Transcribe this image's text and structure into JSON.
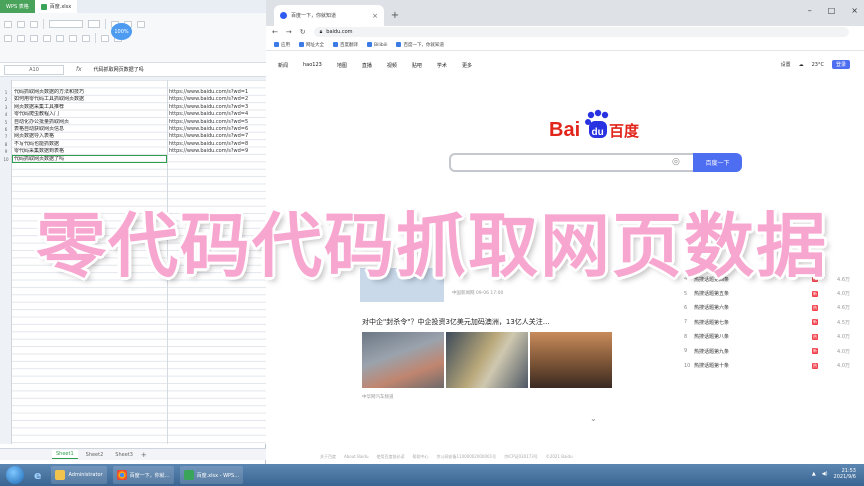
{
  "wps": {
    "tabs": [
      {
        "label": "WPS 表格"
      },
      {
        "label": "百度.xlsx"
      }
    ],
    "toolbar": {
      "zoom": "100%"
    },
    "name_box": "A10",
    "formula": "代码抓取网页数据了吗",
    "rows": [
      {
        "num": "1",
        "a": "代码抓取网页数据的方法和技巧",
        "b": "https://www.baidu.com/s?wd=1"
      },
      {
        "num": "2",
        "a": "如何用零代码工具抓取网页数据",
        "b": "https://www.baidu.com/s?wd=2"
      },
      {
        "num": "3",
        "a": "网页数据采集工具推荐",
        "b": "https://www.baidu.com/s?wd=3"
      },
      {
        "num": "4",
        "a": "零代码爬虫教程入门",
        "b": "https://www.baidu.com/s?wd=4"
      },
      {
        "num": "5",
        "a": "自动化办公批量抓取网页",
        "b": "https://www.baidu.com/s?wd=5"
      },
      {
        "num": "6",
        "a": "表格自动获取网页信息",
        "b": "https://www.baidu.com/s?wd=6"
      },
      {
        "num": "7",
        "a": "网页数据导入表格",
        "b": "https://www.baidu.com/s?wd=7"
      },
      {
        "num": "8",
        "a": "不写代码也能抓数据",
        "b": "https://www.baidu.com/s?wd=8"
      },
      {
        "num": "9",
        "a": "零代码采集数据到表格",
        "b": "https://www.baidu.com/s?wd=9"
      },
      {
        "num": "10",
        "a": "代码抓取网页数据了吗",
        "b": ""
      }
    ],
    "sheets": [
      "Sheet1",
      "Sheet2",
      "Sheet3"
    ],
    "add_sheet": "+"
  },
  "chrome": {
    "tab_title": "百度一下，你就知道",
    "tab_close": "×",
    "new_tab": "+",
    "url": "baidu.com",
    "bookmarks": [
      "应用",
      "网址大全",
      "百度翻译",
      "Bilibili",
      "百度一下，你就知道"
    ]
  },
  "baidu": {
    "nav": [
      "新闻",
      "hao123",
      "地图",
      "直播",
      "视频",
      "贴吧",
      "学术",
      "更多"
    ],
    "right": {
      "settings": "设置",
      "weather": "23°C",
      "login": "登录"
    },
    "logo_text": "Bai du 百度",
    "search_button": "百度一下",
    "news_meta_1": "中国新闻网   09-06 17:00",
    "headline": "对中企\"封杀令\"？中企投资3亿美元加码澳洲，13亿人关注…",
    "news_meta_2": "中华网汽车频道",
    "hot_list": [
      {
        "rank": "4",
        "title": "热搜话题第四条",
        "count": "4.6万"
      },
      {
        "rank": "5",
        "title": "热搜话题第五条",
        "count": "4.0万"
      },
      {
        "rank": "6",
        "title": "热搜话题第六条",
        "count": "4.6万"
      },
      {
        "rank": "7",
        "title": "热搜话题第七条",
        "count": "4.5万"
      },
      {
        "rank": "8",
        "title": "热搜话题第八条",
        "count": "4.0万"
      },
      {
        "rank": "9",
        "title": "热搜话题第九条",
        "count": "4.0万"
      },
      {
        "rank": "10",
        "title": "热搜话题第十条",
        "count": "4.0万"
      }
    ],
    "footer": [
      "关于百度",
      "About Baidu",
      "使用百度前必读",
      "帮助中心",
      "京公网安备11000002000001号",
      "京ICP证030173号",
      "©2021 Baidu"
    ]
  },
  "overlay": {
    "title": "零代码代码抓取网页数据"
  },
  "taskbar": {
    "apps": [
      {
        "label": "Administrator"
      },
      {
        "label": "百度一下，你就…"
      },
      {
        "label": "百度.xlsx - WPS…"
      }
    ],
    "time": "21:53",
    "date": "2021/9/6"
  }
}
